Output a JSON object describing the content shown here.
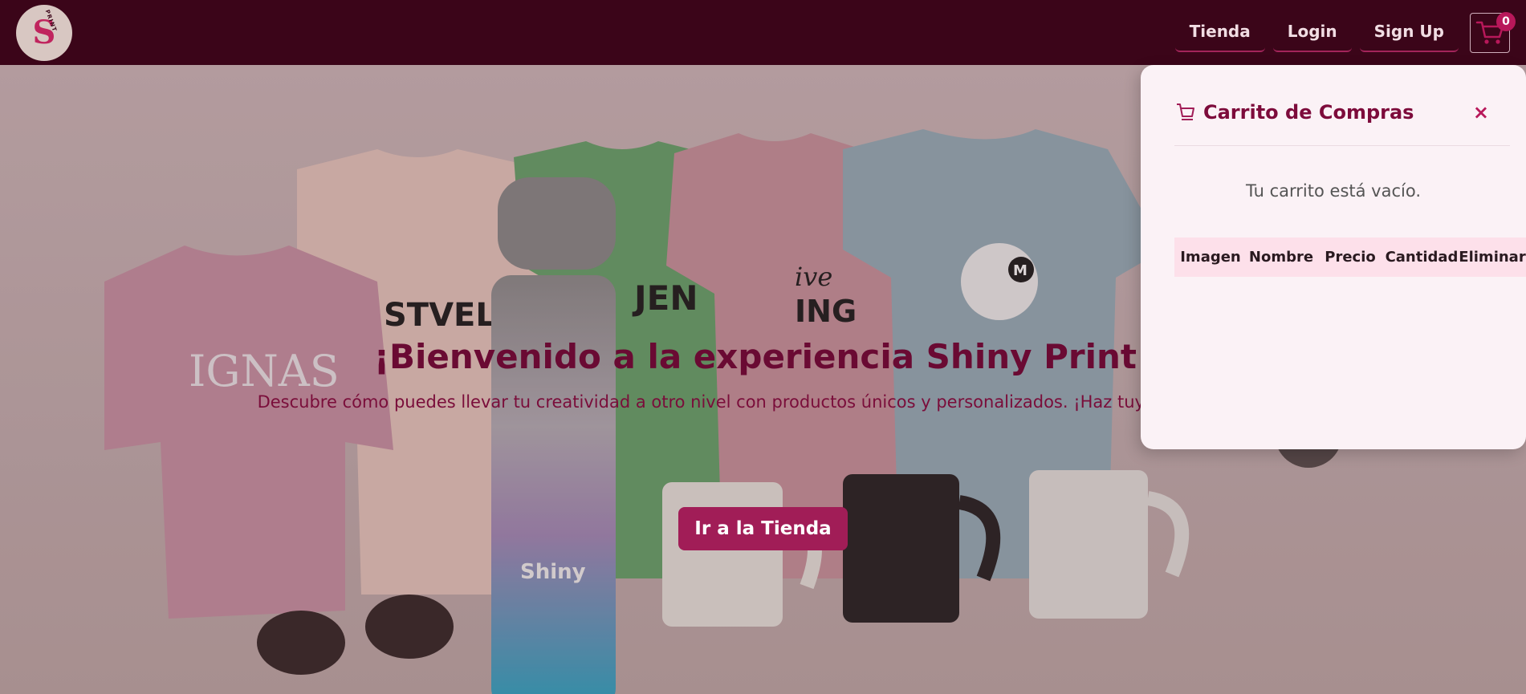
{
  "navbar": {
    "logo_letter": "S",
    "logo_small_text": "PRINT",
    "links": [
      {
        "label": "Tienda"
      },
      {
        "label": "Login"
      },
      {
        "label": "Sign Up"
      }
    ],
    "cart_icon": "shopping-cart-icon",
    "cart_count": "0"
  },
  "hero": {
    "title": "¡Bienvenido a la experiencia Shiny Print!",
    "subtitle": "Descubre cómo puedes llevar tu creatividad a otro nivel con productos únicos y personalizados. ¡Haz tuyo cada diseño!",
    "button_label": "Ir a la Tienda",
    "photo_texts": {
      "shirt1": "IGNAS",
      "shirt2": "STVELH",
      "shirt3": "JEN",
      "shirt4a": "ive",
      "shirt4b": "ING",
      "shirt5": "M",
      "bottle": "Shiny"
    }
  },
  "cart": {
    "title": "Carrito de Compras",
    "title_icon": "cart-outline-icon",
    "close_icon": "close-icon",
    "close_label": "×",
    "empty_message": "Tu carrito está vacío.",
    "columns": [
      "Imagen",
      "Nombre",
      "Precio",
      "Cantidad",
      "Eliminar"
    ]
  },
  "colors": {
    "navbar_bg": "#3b0519",
    "accent": "#a11d57",
    "title_color": "#6a0a33"
  }
}
